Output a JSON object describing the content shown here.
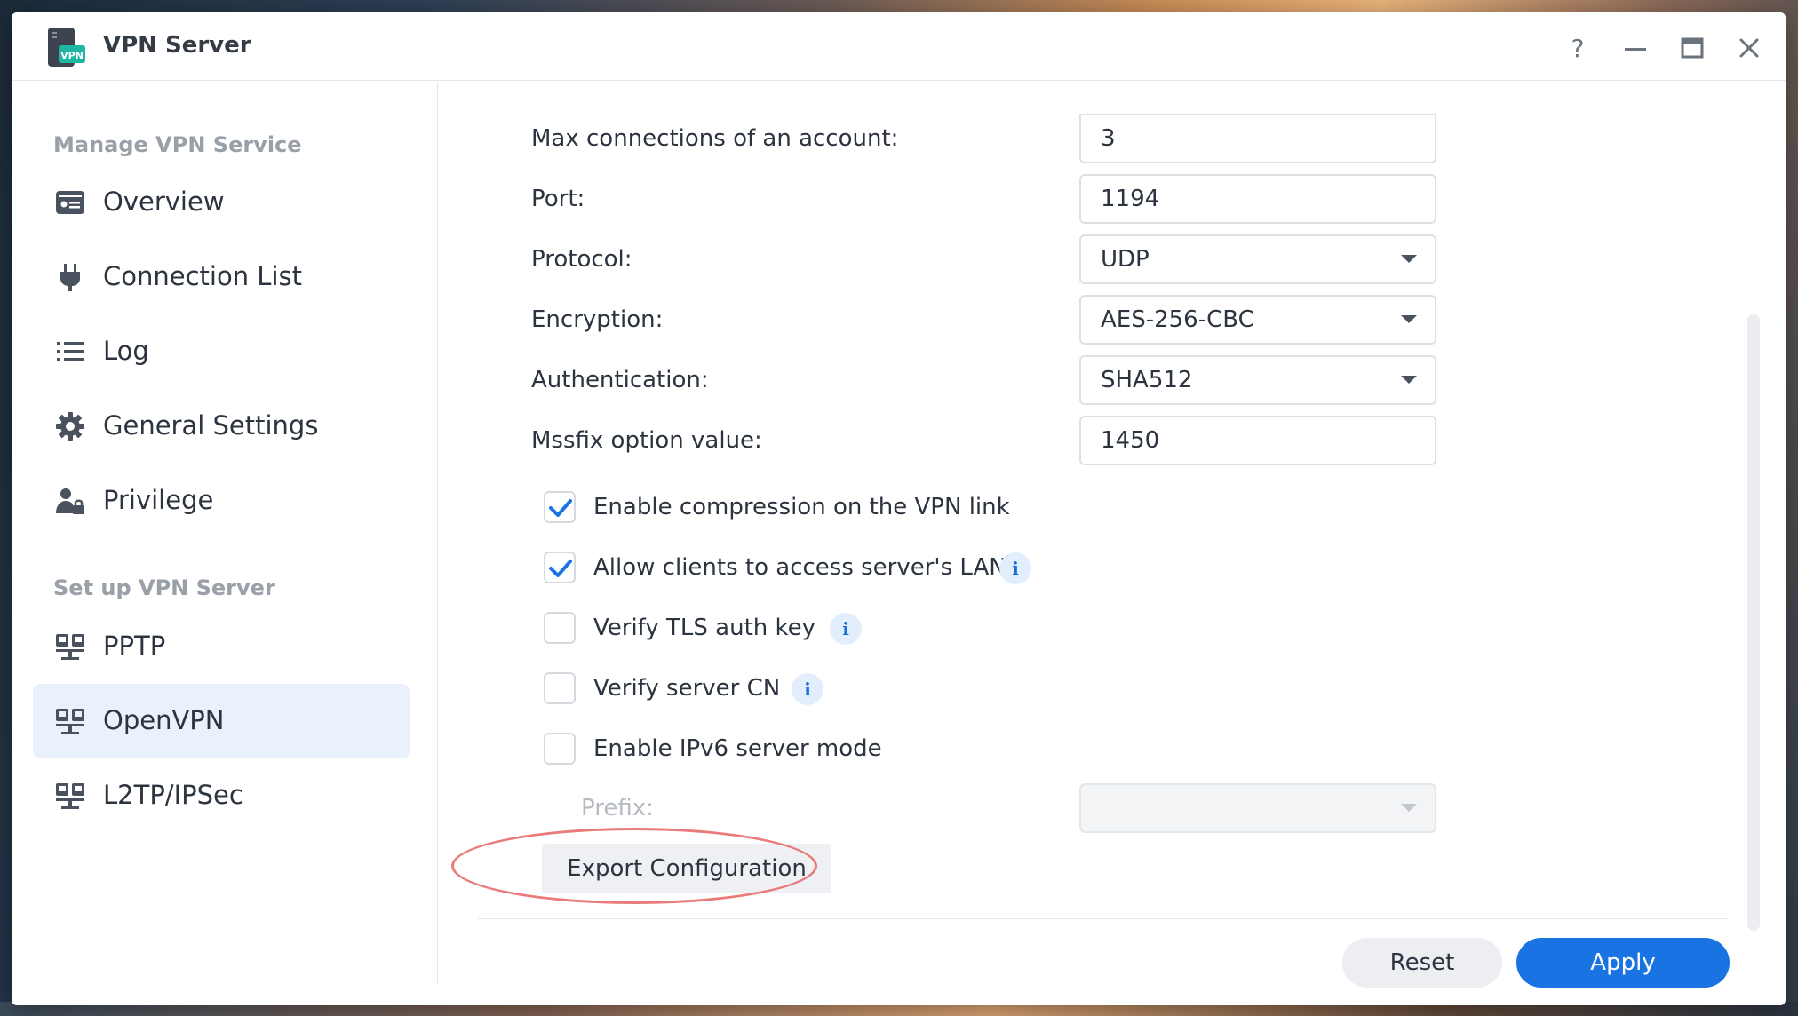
{
  "window": {
    "title": "VPN Server",
    "app_icon": "vpn-server-app-icon",
    "app_icon_badge": "VPN",
    "controls": [
      "help-icon",
      "minimize-icon",
      "maximize-icon",
      "close-icon"
    ],
    "help_label": "?"
  },
  "sidebar": {
    "sections": [
      {
        "title": "Manage VPN Service",
        "items": [
          {
            "label": "Overview",
            "icon": "overview-icon"
          },
          {
            "label": "Connection List",
            "icon": "plug-icon"
          },
          {
            "label": "Log",
            "icon": "list-icon"
          },
          {
            "label": "General Settings",
            "icon": "gear-icon"
          },
          {
            "label": "Privilege",
            "icon": "user-lock-icon"
          }
        ]
      },
      {
        "title": "Set up VPN Server",
        "items": [
          {
            "label": "PPTP",
            "icon": "network-icon"
          },
          {
            "label": "OpenVPN",
            "icon": "network-icon",
            "active": true
          },
          {
            "label": "L2TP/IPSec",
            "icon": "network-icon"
          }
        ]
      }
    ]
  },
  "form": {
    "fields": [
      {
        "label": "Max connections of an account:",
        "value": "3",
        "type": "text"
      },
      {
        "label": "Port:",
        "value": "1194",
        "type": "text"
      },
      {
        "label": "Protocol:",
        "value": "UDP",
        "type": "select"
      },
      {
        "label": "Encryption:",
        "value": "AES-256-CBC",
        "type": "select"
      },
      {
        "label": "Authentication:",
        "value": "SHA512",
        "type": "select"
      },
      {
        "label": "Mssfix option value:",
        "value": "1450",
        "type": "text"
      }
    ],
    "checkboxes": [
      {
        "label": "Enable compression on the VPN link",
        "checked": true,
        "info": false
      },
      {
        "label": "Allow clients to access server's LAN",
        "checked": true,
        "info": true
      },
      {
        "label": "Verify TLS auth key",
        "checked": false,
        "info": true
      },
      {
        "label": "Verify server CN",
        "checked": false,
        "info": true
      },
      {
        "label": "Enable IPv6 server mode",
        "checked": false,
        "info": false
      }
    ],
    "prefix": {
      "label": "Prefix:",
      "value": "",
      "disabled": true
    },
    "info_glyph": "i",
    "export_button": "Export Configuration"
  },
  "footer": {
    "reset_label": "Reset",
    "apply_label": "Apply"
  },
  "colors": {
    "accent": "#1a73e3",
    "active_nav_bg": "#e8f1fc",
    "highlight_ellipse": "#e97b7b",
    "info_icon": "#1a6ed8"
  }
}
